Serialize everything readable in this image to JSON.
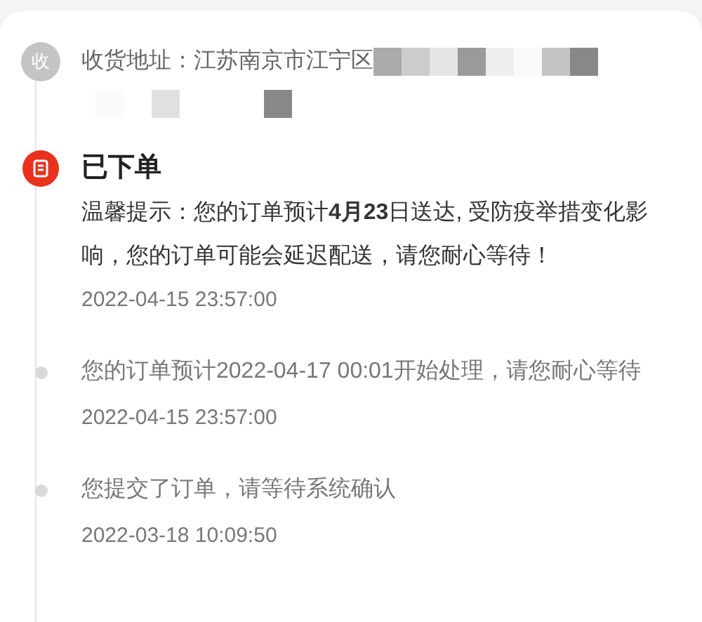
{
  "address": {
    "badge": "收",
    "text": "收货地址：江苏南京市江宁区"
  },
  "events": [
    {
      "kind": "current",
      "title": "已下单",
      "message": "温馨提示：您的订单预计**4月23**日送达, 受防疫举措变化影响，您的订单可能会延迟配送，请您耐心等待！",
      "time": "2022-04-15 23:57:00"
    },
    {
      "kind": "past",
      "message": "您的订单预计2022-04-17 00:01开始处理，请您耐心等待",
      "time": "2022-04-15 23:57:00"
    },
    {
      "kind": "past",
      "message": "您提交了订单，请等待系统确认",
      "time": "2022-03-18 10:09:50"
    }
  ]
}
